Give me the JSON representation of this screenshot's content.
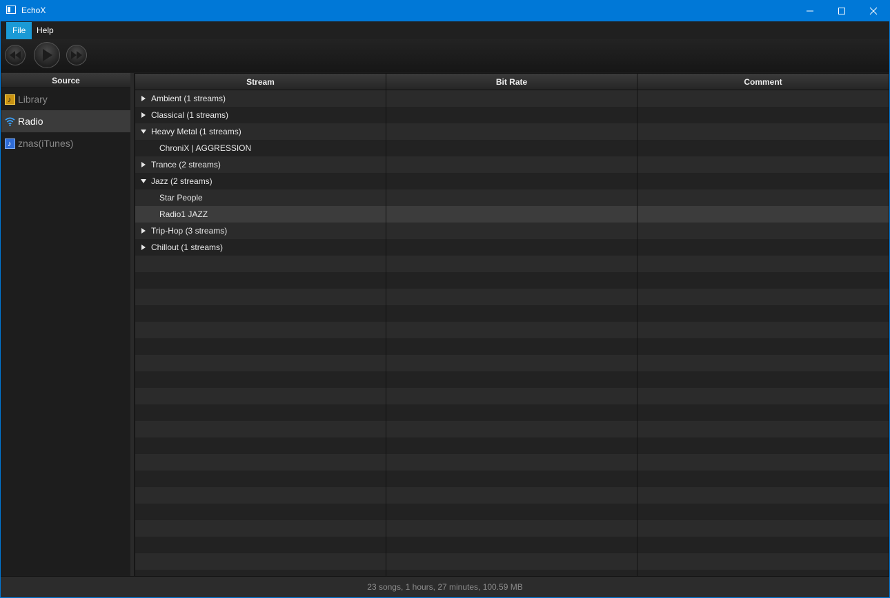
{
  "window": {
    "title": "EchoX",
    "accent": "#0078d7"
  },
  "menu": [
    {
      "label": "File",
      "active": true
    },
    {
      "label": "Help",
      "active": false
    }
  ],
  "toolbar": {
    "prev_icon": "rewind-icon",
    "play_icon": "play-icon",
    "next_icon": "fast-forward-icon"
  },
  "source": {
    "header": "Source",
    "items": [
      {
        "label": "Library",
        "icon": "library-icon",
        "selected": false
      },
      {
        "label": "Radio",
        "icon": "wifi-icon",
        "selected": true
      },
      {
        "label": "znas(iTunes)",
        "icon": "itunes-icon",
        "selected": false
      }
    ]
  },
  "table": {
    "columns": [
      "Stream",
      "Bit Rate",
      "Comment"
    ],
    "rows": [
      {
        "label": "Ambient (1 streams)",
        "type": "group",
        "expanded": false
      },
      {
        "label": "Classical (1 streams)",
        "type": "group",
        "expanded": false
      },
      {
        "label": "Heavy Metal (1 streams)",
        "type": "group",
        "expanded": true
      },
      {
        "label": "ChroniX | AGGRESSION",
        "type": "stream"
      },
      {
        "label": "Trance (2 streams)",
        "type": "group",
        "expanded": false
      },
      {
        "label": "Jazz (2 streams)",
        "type": "group",
        "expanded": true
      },
      {
        "label": "Star People",
        "type": "stream"
      },
      {
        "label": "Radio1 JAZZ",
        "type": "stream",
        "selected": true
      },
      {
        "label": "Trip-Hop (3 streams)",
        "type": "group",
        "expanded": false
      },
      {
        "label": "Chillout (1 streams)",
        "type": "group",
        "expanded": false
      }
    ]
  },
  "status": {
    "text": "23 songs, 1 hours, 27 minutes, 100.59 MB"
  }
}
